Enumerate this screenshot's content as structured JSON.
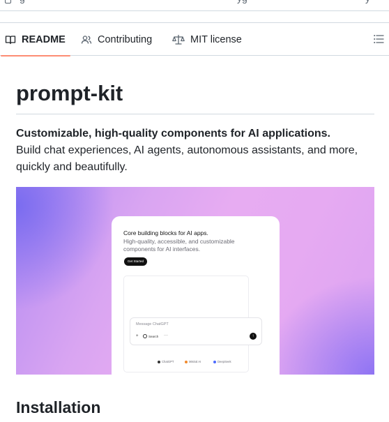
{
  "top_strip": {
    "fragment_left": "g",
    "fragment_mid": "yg",
    "fragment_right": "y"
  },
  "tabs": [
    {
      "label": "README",
      "icon": "book-icon",
      "active": true
    },
    {
      "label": "Contributing",
      "icon": "people-icon",
      "active": false
    },
    {
      "label": "MIT license",
      "icon": "law-icon",
      "active": false
    }
  ],
  "toc_icon": "list-unordered-icon",
  "readme": {
    "title": "prompt-kit",
    "tagline_bold": "Customizable, high-quality components for AI applications.",
    "tagline_rest": "Build chat experiences, AI agents, autonomous assistants, and more, quickly and beautifully.",
    "hero": {
      "card_title": "Core building blocks for AI apps.",
      "card_subtitle": "High-quality, accessible, and customizable components for AI interfaces.",
      "cta_label": "Get Started",
      "message_placeholder": "Message ChatGPT",
      "plus_label": "+",
      "search_label": "Search",
      "more_label": "···",
      "send_icon": "arrow-up-icon",
      "models": [
        {
          "label": "ChatGPT",
          "color": "#333333"
        },
        {
          "label": "Mistral AI",
          "color": "#f08a2c"
        },
        {
          "label": "DeepSeek",
          "color": "#4d6bfe"
        }
      ]
    },
    "section_heading": "Installation"
  },
  "colors": {
    "tab_underline": "#fd8c73",
    "border": "#d1d9e0",
    "text": "#1f2328"
  }
}
